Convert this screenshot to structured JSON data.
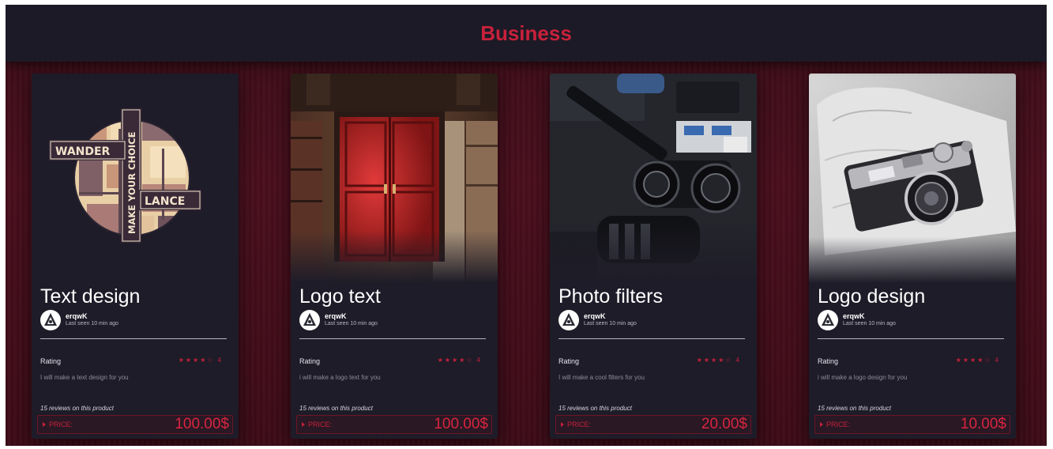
{
  "header": {
    "title": "Business"
  },
  "cards": [
    {
      "image": "wanderlance-logo-image",
      "title": "Text design",
      "seller_name": "erqwK",
      "seller_status": "Last seen 10 min ago",
      "rating_label": "Rating",
      "rating_stars": "★★★★☆",
      "rating_value": "4",
      "description": "I will make a text design for you",
      "reviews": "15 reviews on this product",
      "price_label": "PRICE:",
      "price": "100.00$",
      "logo_text_1": "WANDER",
      "logo_text_2": "MAKE YOUR CHOICE",
      "logo_text_3": "LANCE"
    },
    {
      "image": "red-door-photo",
      "title": "Logo text",
      "seller_name": "erqwK",
      "seller_status": "Last seen 10 min ago",
      "rating_label": "Rating",
      "rating_stars": "★★★★☆",
      "rating_value": "4",
      "description": "i will make a logo text for you",
      "reviews": "15 reviews on this product",
      "price_label": "PRICE:",
      "price": "100.00$"
    },
    {
      "image": "camera-gear-photo",
      "title": "Photo filters",
      "seller_name": "erqwK",
      "seller_status": "Last seen 10 min ago",
      "rating_label": "Rating",
      "rating_stars": "★★★★☆",
      "rating_value": "4",
      "description": "I will make a cool filters for you",
      "reviews": "15 reviews on this product",
      "price_label": "PRICE:",
      "price": "20.00$"
    },
    {
      "image": "vintage-camera-photo",
      "title": "Logo design",
      "seller_name": "erqwK",
      "seller_status": "Last seen 10 min ago",
      "rating_label": "Rating",
      "rating_stars": "★★★★☆",
      "rating_value": "4",
      "description": "i will make a logo design for you",
      "reviews": "15 reviews on this product",
      "price_label": "PRICE:",
      "price": "10.00$"
    }
  ],
  "colors": {
    "accent": "#c8213b",
    "header_bg": "#1c1a26",
    "card_bg": "#1e1c28",
    "page_bg": "#4b0f1e"
  }
}
